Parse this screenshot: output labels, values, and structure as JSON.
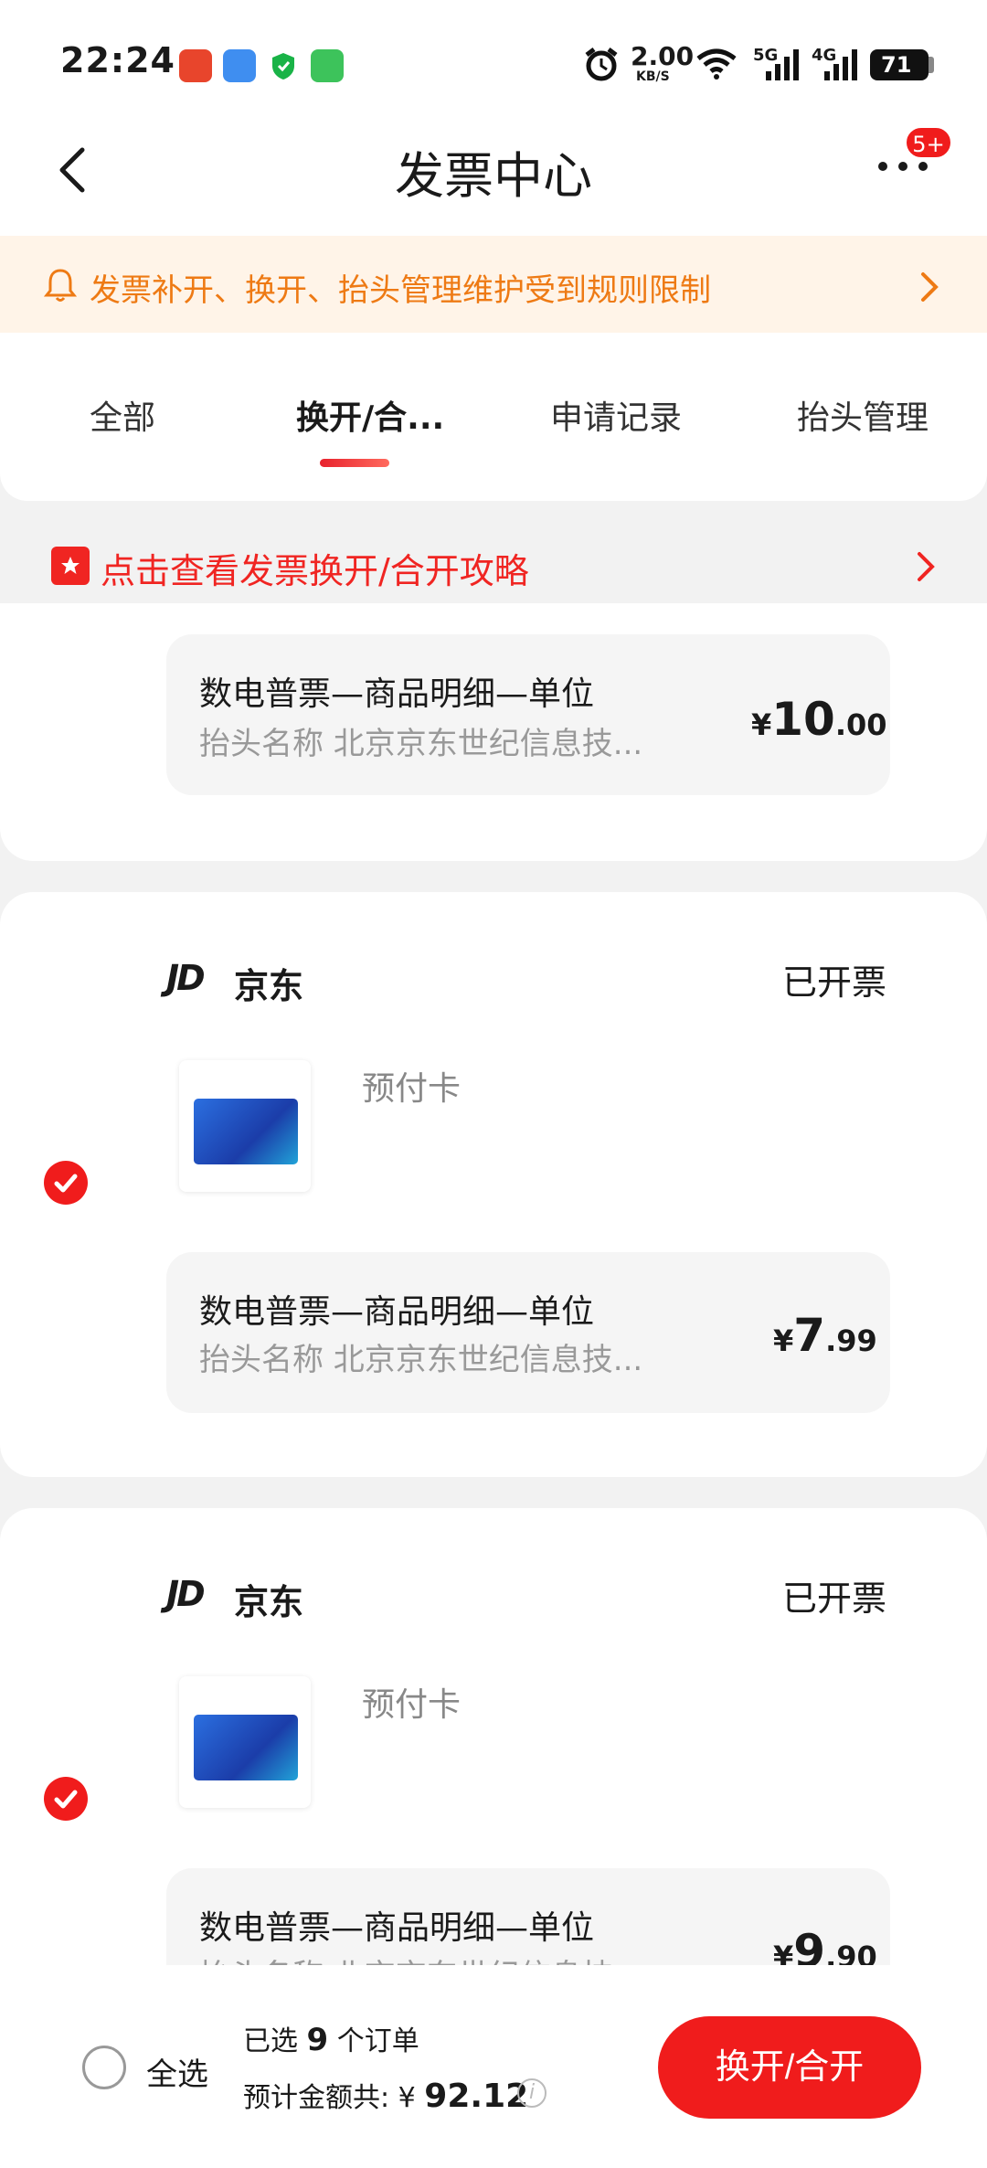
{
  "status_bar": {
    "time": "22:24",
    "net_speed_value": "2.00",
    "net_speed_unit": "KB/S",
    "signal_1": "5G",
    "signal_2": "4G",
    "battery": "71"
  },
  "nav": {
    "title": "发票中心",
    "more_badge": "5+"
  },
  "notice": {
    "text": "发票补开、换开、抬头管理维护受到规则限制"
  },
  "tabs": [
    {
      "label": "全部"
    },
    {
      "label": "换开/合..."
    },
    {
      "label": "申请记录"
    },
    {
      "label": "抬头管理"
    }
  ],
  "guide": {
    "text": "点击查看发票换开/合开攻略"
  },
  "cards": [
    {
      "invoice_title": "数电普票—商品明细—单位",
      "invoice_sub": "抬头名称 北京京东世纪信息技...",
      "amount_symbol": "¥",
      "amount_int": "10",
      "amount_dec": ".00"
    },
    {
      "shop_logo": "JD",
      "shop_name": "京东",
      "status": "已开票",
      "product": "预付卡",
      "invoice_title": "数电普票—商品明细—单位",
      "invoice_sub": "抬头名称 北京京东世纪信息技...",
      "amount_symbol": "¥",
      "amount_int": "7",
      "amount_dec": ".99",
      "checked": true
    },
    {
      "shop_logo": "JD",
      "shop_name": "京东",
      "status": "已开票",
      "product": "预付卡",
      "invoice_title": "数电普票—商品明细—单位",
      "invoice_sub": "抬头名称 北京京东世纪信息技...",
      "amount_symbol": "¥",
      "amount_int": "9",
      "amount_dec": ".90",
      "checked": true
    }
  ],
  "bottom": {
    "select_all": "全选",
    "selected_prefix": "已选",
    "selected_count": "9",
    "selected_suffix": "个订单",
    "total_label": "预计金额共:",
    "total_symbol": "¥",
    "total_amount": "92.12",
    "action": "换开/合开"
  },
  "colors": {
    "accent": "#f01c1c",
    "notice_text": "#ee7a14",
    "notice_bg": "#fff4e8"
  }
}
